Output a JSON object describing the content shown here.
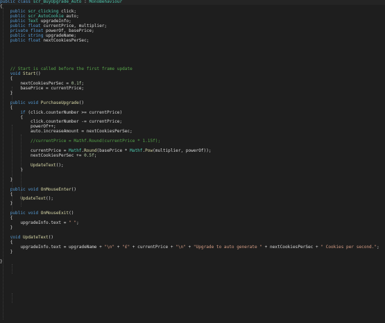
{
  "editor": {
    "language": "csharp",
    "colors": {
      "background": "#1e1e1e",
      "text": "#dcdcdc",
      "keyword": "#569cd6",
      "type": "#4ec9b0",
      "string": "#d69d85",
      "number": "#b5cea8",
      "comment": "#57a64a",
      "method": "#dcdcaa",
      "guide": "#3c3c3c"
    },
    "lines": [
      [
        [
          "keyword",
          "public"
        ],
        [
          "text",
          " "
        ],
        [
          "keyword",
          "class"
        ],
        [
          "text",
          " "
        ],
        [
          "type",
          "scr_BuyUpgrade_Auto"
        ],
        [
          "text",
          " : "
        ],
        [
          "type",
          "MonoBehaviour"
        ]
      ],
      [
        [
          "text",
          "{"
        ]
      ],
      [
        [
          "text",
          "    "
        ],
        [
          "keyword",
          "public"
        ],
        [
          "text",
          " "
        ],
        [
          "type",
          "scr_clicking"
        ],
        [
          "text",
          " click;"
        ]
      ],
      [
        [
          "text",
          "    "
        ],
        [
          "keyword",
          "public"
        ],
        [
          "text",
          " "
        ],
        [
          "type",
          "scr_AutoCookie"
        ],
        [
          "text",
          " auto;"
        ]
      ],
      [
        [
          "text",
          "    "
        ],
        [
          "keyword",
          "public"
        ],
        [
          "text",
          " "
        ],
        [
          "type",
          "Text"
        ],
        [
          "text",
          " upgradeInfo;"
        ]
      ],
      [
        [
          "text",
          "    "
        ],
        [
          "keyword",
          "public"
        ],
        [
          "text",
          " "
        ],
        [
          "keyword",
          "float"
        ],
        [
          "text",
          " currentPrice, multiplier;"
        ]
      ],
      [
        [
          "text",
          "    "
        ],
        [
          "keyword",
          "private"
        ],
        [
          "text",
          " "
        ],
        [
          "keyword",
          "float"
        ],
        [
          "text",
          " powerOf, basePrice;"
        ]
      ],
      [
        [
          "text",
          "    "
        ],
        [
          "keyword",
          "public"
        ],
        [
          "text",
          " "
        ],
        [
          "keyword",
          "string"
        ],
        [
          "text",
          " upgradeName;"
        ]
      ],
      [
        [
          "text",
          "    "
        ],
        [
          "keyword",
          "public"
        ],
        [
          "text",
          " "
        ],
        [
          "keyword",
          "float"
        ],
        [
          "text",
          " nextCookiesPerSec;"
        ]
      ],
      [],
      [],
      [],
      [],
      [],
      [
        [
          "text",
          "    "
        ],
        [
          "comment",
          "// Start is called before the first frame update"
        ]
      ],
      [
        [
          "text",
          "    "
        ],
        [
          "keyword",
          "void"
        ],
        [
          "text",
          " "
        ],
        [
          "method",
          "Start"
        ],
        [
          "text",
          "()"
        ]
      ],
      [
        [
          "text",
          "    {"
        ]
      ],
      [
        [
          "text",
          "        nextCookiesPerSec = "
        ],
        [
          "number",
          "0.1f"
        ],
        [
          "text",
          ";"
        ]
      ],
      [
        [
          "text",
          "        basePrice = currentPrice;"
        ]
      ],
      [
        [
          "text",
          "    }"
        ]
      ],
      [],
      [
        [
          "text",
          "    "
        ],
        [
          "keyword",
          "public"
        ],
        [
          "text",
          " "
        ],
        [
          "keyword",
          "void"
        ],
        [
          "text",
          " "
        ],
        [
          "method",
          "PurchaseUpgrade"
        ],
        [
          "text",
          "()"
        ]
      ],
      [
        [
          "text",
          "    {"
        ]
      ],
      [
        [
          "text",
          "        "
        ],
        [
          "keyword",
          "if"
        ],
        [
          "text",
          " (click.counterNumber >= currentPrice)"
        ]
      ],
      [
        [
          "text",
          "        {"
        ]
      ],
      [
        [
          "text",
          "            click.counterNumber -= currentPrice;"
        ]
      ],
      [
        [
          "text",
          "            powerOf++;"
        ]
      ],
      [
        [
          "text",
          "            auto.increaseAmount = nextCookiesPerSec;"
        ]
      ],
      [],
      [
        [
          "text",
          "            "
        ],
        [
          "comment",
          "//currentPrice = Mathf.Round(currentPrice * 1.15f);"
        ]
      ],
      [],
      [
        [
          "text",
          "            currentPrice = "
        ],
        [
          "type",
          "Mathf"
        ],
        [
          "text",
          "."
        ],
        [
          "method",
          "Round"
        ],
        [
          "text",
          "(basePrice * "
        ],
        [
          "type",
          "Mathf"
        ],
        [
          "text",
          "."
        ],
        [
          "method",
          "Pow"
        ],
        [
          "text",
          "(multiplier, powerOf));"
        ]
      ],
      [
        [
          "text",
          "            nextCookiesPerSec += "
        ],
        [
          "number",
          "0.5f"
        ],
        [
          "text",
          ";"
        ]
      ],
      [],
      [
        [
          "text",
          "            "
        ],
        [
          "method",
          "UpdateText"
        ],
        [
          "text",
          "();"
        ]
      ],
      [
        [
          "text",
          "        }"
        ]
      ],
      [],
      [
        [
          "text",
          "    }"
        ]
      ],
      [],
      [
        [
          "text",
          "    "
        ],
        [
          "keyword",
          "public"
        ],
        [
          "text",
          " "
        ],
        [
          "keyword",
          "void"
        ],
        [
          "text",
          " "
        ],
        [
          "method",
          "OnMouseEnter"
        ],
        [
          "text",
          "()"
        ]
      ],
      [
        [
          "text",
          "    {"
        ]
      ],
      [
        [
          "text",
          "        "
        ],
        [
          "method",
          "UpdateText"
        ],
        [
          "text",
          "();"
        ]
      ],
      [
        [
          "text",
          "    }"
        ]
      ],
      [],
      [
        [
          "text",
          "    "
        ],
        [
          "keyword",
          "public"
        ],
        [
          "text",
          " "
        ],
        [
          "keyword",
          "void"
        ],
        [
          "text",
          " "
        ],
        [
          "method",
          "OnMouseExit"
        ],
        [
          "text",
          "()"
        ]
      ],
      [
        [
          "text",
          "    {"
        ]
      ],
      [
        [
          "text",
          "        upgradeInfo.text = "
        ],
        [
          "string",
          "\" \""
        ],
        [
          "text",
          ";"
        ]
      ],
      [
        [
          "text",
          "    }"
        ]
      ],
      [],
      [
        [
          "text",
          "    "
        ],
        [
          "keyword",
          "void"
        ],
        [
          "text",
          " "
        ],
        [
          "method",
          "UpdateText"
        ],
        [
          "text",
          "()"
        ]
      ],
      [
        [
          "text",
          "    {"
        ]
      ],
      [
        [
          "text",
          "        upgradeInfo.text = upgradeName + "
        ],
        [
          "string",
          "\"\\n\""
        ],
        [
          "text",
          " + "
        ],
        [
          "string",
          "\"£\""
        ],
        [
          "text",
          " + currentPrice + "
        ],
        [
          "string",
          "\"\\n\""
        ],
        [
          "text",
          " + "
        ],
        [
          "string",
          "\"Upgrade to auto generate \""
        ],
        [
          "text",
          " + nextCookiesPerSec + "
        ],
        [
          "string",
          "\" Cookies per second.\""
        ],
        [
          "text",
          ";"
        ]
      ],
      [
        [
          "text",
          "    }"
        ]
      ],
      [],
      [
        [
          "text",
          "}"
        ]
      ]
    ]
  }
}
